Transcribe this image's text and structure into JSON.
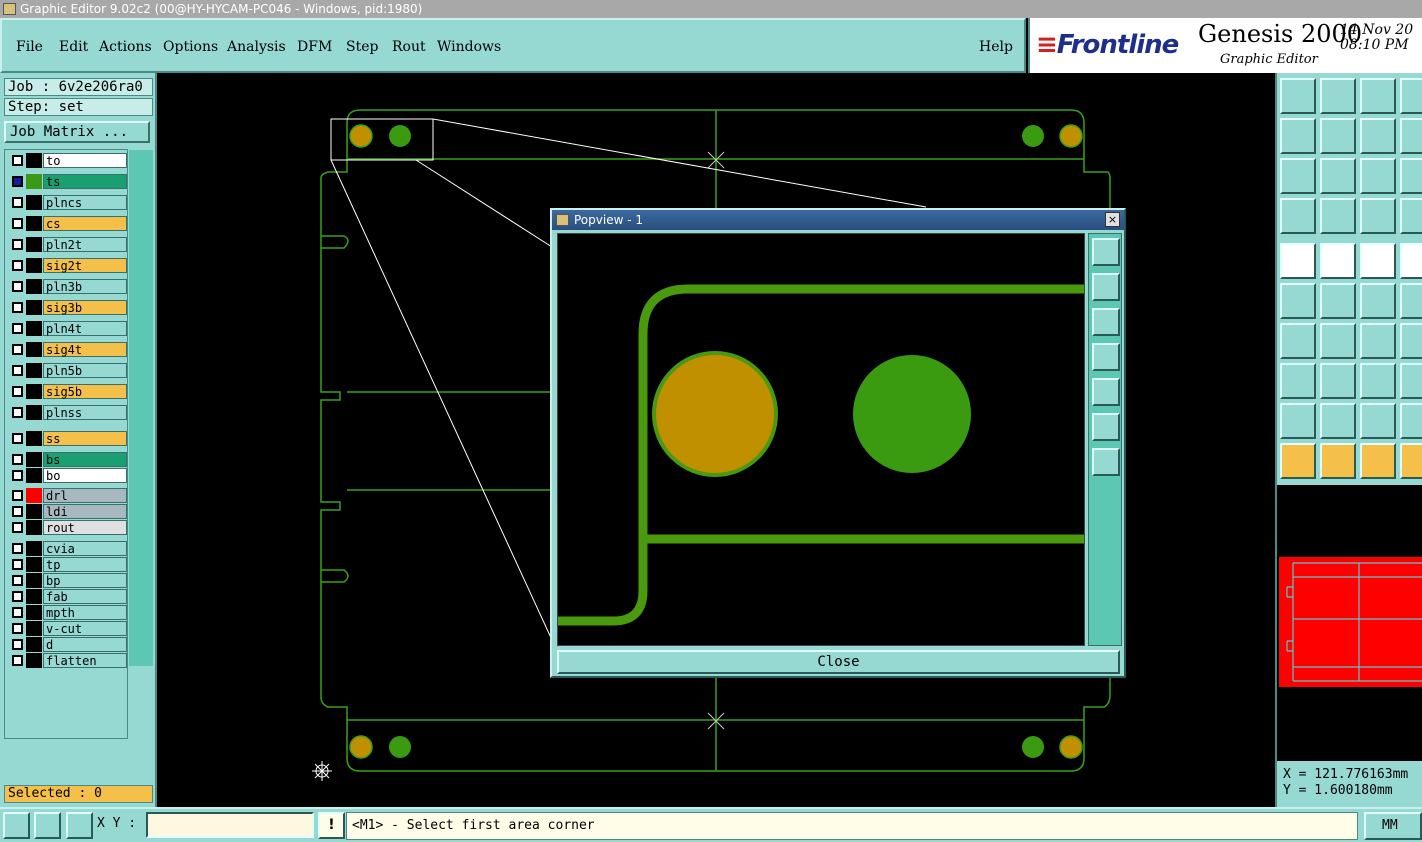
{
  "window": {
    "title": "Graphic Editor 9.02c2 (00@HY-HYCAM-PC046 - Windows, pid:1980)"
  },
  "menu": {
    "items": [
      "File",
      "Edit",
      "Actions",
      "Options",
      "Analysis",
      "DFM",
      "Step",
      "Rout",
      "Windows"
    ],
    "help": "Help"
  },
  "brand": {
    "logo": "Frontline",
    "product": "Genesis 2000",
    "subtitle": "Graphic Editor",
    "date": "14 Nov 20",
    "time": "08:10 PM"
  },
  "job": {
    "job_label": "Job : 6v2e206ra0",
    "step_label": "Step: set",
    "matrix_button": "Job Matrix ..."
  },
  "layers": [
    {
      "name": "to",
      "color": "#ffffff",
      "swatch": "#000000"
    },
    {
      "name": "ts",
      "color": "#1aa070",
      "swatch": "#3a9a18",
      "active": true
    },
    {
      "name": "plncs",
      "color": "#96d8d2",
      "swatch": "#000000"
    },
    {
      "name": "cs",
      "color": "#f5c04a",
      "swatch": "#000000"
    },
    {
      "name": "pln2t",
      "color": "#96d8d2",
      "swatch": "#000000"
    },
    {
      "name": "sig2t",
      "color": "#f5c04a",
      "swatch": "#000000"
    },
    {
      "name": "pln3b",
      "color": "#96d8d2",
      "swatch": "#000000"
    },
    {
      "name": "sig3b",
      "color": "#f5c04a",
      "swatch": "#000000"
    },
    {
      "name": "pln4t",
      "color": "#96d8d2",
      "swatch": "#000000"
    },
    {
      "name": "sig4t",
      "color": "#f5c04a",
      "swatch": "#000000"
    },
    {
      "name": "pln5b",
      "color": "#96d8d2",
      "swatch": "#000000"
    },
    {
      "name": "sig5b",
      "color": "#f5c04a",
      "swatch": "#000000"
    },
    {
      "name": "plnss",
      "color": "#96d8d2",
      "swatch": "#000000"
    },
    {
      "name": "ss",
      "color": "#f5c04a",
      "swatch": "#000000"
    },
    {
      "name": "bs",
      "color": "#1aa070",
      "swatch": "#000000"
    },
    {
      "name": "bo",
      "color": "#ffffff",
      "swatch": "#000000"
    },
    {
      "name": "drl",
      "color": "#a8b8c0",
      "swatch": "#ff0000"
    },
    {
      "name": "ldi",
      "color": "#a8b8c0",
      "swatch": "#000000"
    },
    {
      "name": "rout",
      "color": "#e0e0e0",
      "swatch": "#000000"
    },
    {
      "name": "cvia",
      "color": "#96d8d2",
      "swatch": "#000000"
    },
    {
      "name": "tp",
      "color": "#96d8d2",
      "swatch": "#000000"
    },
    {
      "name": "bp",
      "color": "#96d8d2",
      "swatch": "#000000"
    },
    {
      "name": "fab",
      "color": "#96d8d2",
      "swatch": "#000000"
    },
    {
      "name": "mpth",
      "color": "#96d8d2",
      "swatch": "#000000"
    },
    {
      "name": "v-cut",
      "color": "#96d8d2",
      "swatch": "#000000"
    },
    {
      "name": "d",
      "color": "#96d8d2",
      "swatch": "#000000"
    },
    {
      "name": "flatten",
      "color": "#96d8d2",
      "swatch": "#000000"
    }
  ],
  "selected": "Selected : 0",
  "popup": {
    "title": "Popview - 1",
    "close_label": "Close",
    "close_icon": "×"
  },
  "coords": {
    "x": "X = 121.776163mm",
    "y": "Y = 1.600180mm"
  },
  "status": {
    "xy_label": "X Y :",
    "xy_value": "",
    "message": "<M1> - Select first area corner",
    "units": "MM"
  },
  "colors": {
    "accent": "#96d8d2",
    "board_outline": "#3aa018",
    "pad_gold": "#c09000",
    "pad_green": "#3a9a10"
  }
}
